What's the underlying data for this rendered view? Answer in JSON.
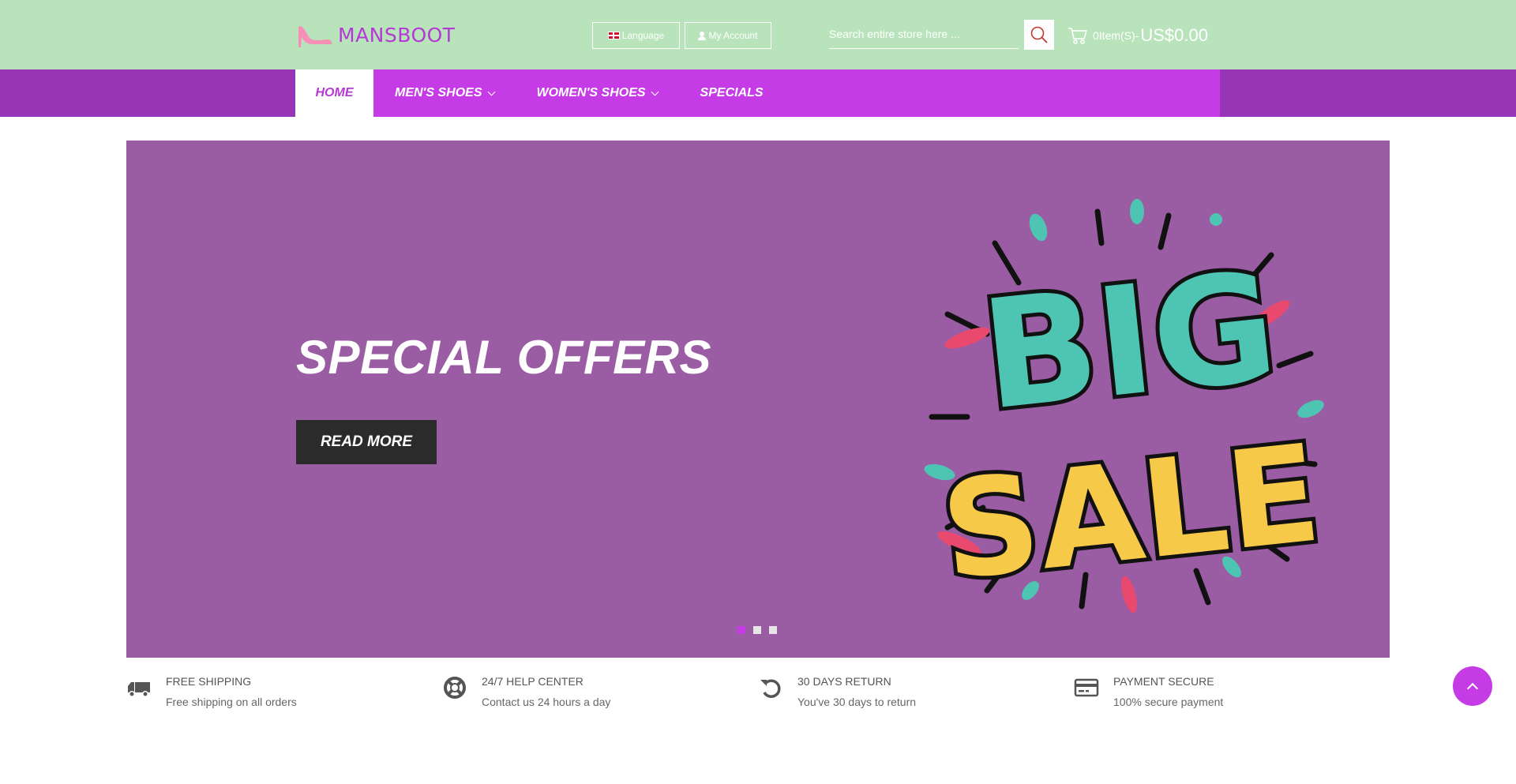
{
  "header": {
    "logo_text": "MANSBOOT",
    "language_label": "Language",
    "account_label": "My Account",
    "search_placeholder": "Search entire store here ...",
    "cart_items": "0Item(S)-",
    "cart_total": "US$0.00"
  },
  "nav": {
    "items": [
      {
        "label": "HOME",
        "active": true
      },
      {
        "label": "MEN'S SHOES",
        "dropdown": true
      },
      {
        "label": "WOMEN'S SHOES",
        "dropdown": true
      },
      {
        "label": "SPECIALS"
      }
    ]
  },
  "hero": {
    "title": "SPECIAL OFFERS",
    "button_label": "READ MORE",
    "artwork_text_line1": "BIG",
    "artwork_text_line2": "SALE",
    "slide_count": 3,
    "active_slide": 1
  },
  "features": [
    {
      "icon": "truck-icon",
      "title": "FREE SHIPPING",
      "desc": "Free shipping on all orders"
    },
    {
      "icon": "lifebuoy-icon",
      "title": "24/7 HELP CENTER",
      "desc": "Contact us 24 hours a day"
    },
    {
      "icon": "return-icon",
      "title": "30 DAYS RETURN",
      "desc": "You've 30 days to return"
    },
    {
      "icon": "credit-card-icon",
      "title": "PAYMENT SECURE",
      "desc": "100% secure payment"
    }
  ],
  "colors": {
    "header_bg": "#b9e4bb",
    "nav_outer": "#9835b6",
    "nav_inner": "#c53be6",
    "accent": "#b43ad4",
    "hero_bg": "#9a5da3",
    "button_dark": "#2b2b2b"
  }
}
